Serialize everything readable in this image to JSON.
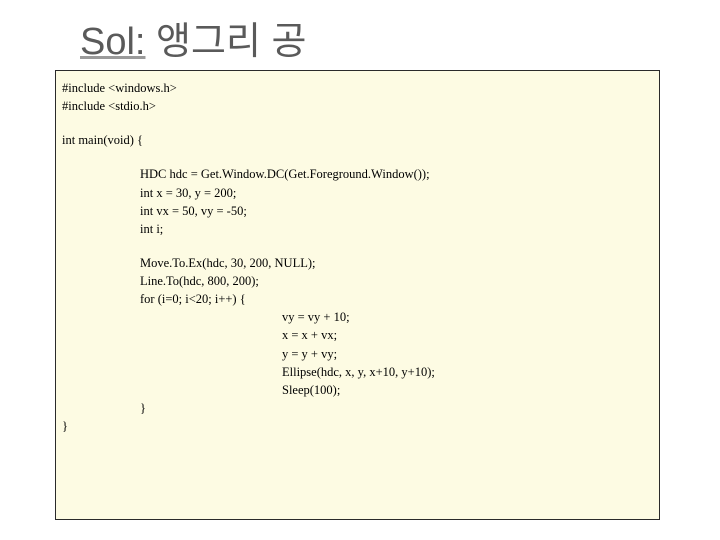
{
  "title": {
    "prefix": "Sol:",
    "rest": " 앵그리 공"
  },
  "code": {
    "l1": "#include <windows.h>",
    "l2": "#include <stdio.h>",
    "l3": "int main(void) {",
    "l4": "HDC hdc = Get.Window.DC(Get.Foreground.Window());",
    "l5": "int x = 30, y = 200;",
    "l6": "int vx = 50, vy = -50;",
    "l7": "int i;",
    "l8": "Move.To.Ex(hdc, 30, 200, NULL);",
    "l9": "Line.To(hdc, 800, 200);",
    "l10": "for (i=0; i<20; i++) {",
    "l11": "vy = vy + 10;",
    "l12": "x = x + vx;",
    "l13": "y = y + vy;",
    "l14": "Ellipse(hdc, x, y, x+10, y+10);",
    "l15": "Sleep(100);",
    "l16": "}",
    "l17": "}"
  }
}
